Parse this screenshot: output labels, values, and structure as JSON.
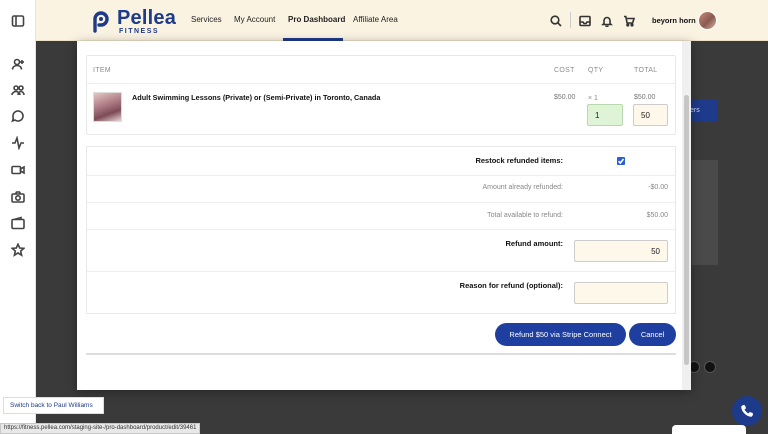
{
  "brand": {
    "name": "Pellea",
    "sub": "FITNESS",
    "color": "#1e3a8a"
  },
  "nav": {
    "links": [
      "Services",
      "My Account",
      "Pro Dashboard",
      "Affiliate Area"
    ],
    "active": "Pro Dashboard"
  },
  "user": {
    "name": "beyorn horn"
  },
  "sidebar": {
    "icons": [
      "panel-toggle-icon",
      "user-add-icon",
      "users-icon",
      "chat-icon",
      "activity-icon",
      "video-icon",
      "camera-icon",
      "wallet-icon",
      "star-icon"
    ]
  },
  "items_table": {
    "headers": {
      "item": "ITEM",
      "cost": "COST",
      "qty": "QTY",
      "total": "TOTAL"
    },
    "row": {
      "name": "Adult Swimming Lessons (Private) or (Semi-Private) in Toronto, Canada",
      "cost": "$50.00",
      "qty_label": "× 1",
      "total": "$50.00",
      "qty_input": "1",
      "total_input": "50"
    }
  },
  "refund": {
    "restock_label": "Restock refunded items:",
    "restock_checked": true,
    "already_refunded_label": "Amount already refunded:",
    "already_refunded_value": "-$0.00",
    "available_label": "Total available to refund:",
    "available_value": "$50.00",
    "amount_label": "Refund amount:",
    "amount_value": "50",
    "reason_label": "Reason for refund (optional):",
    "reason_value": ""
  },
  "actions": {
    "refund_button": "Refund $50 via Stripe Connect",
    "cancel_button": "Cancel"
  },
  "overlays": {
    "switch_back": "Switch back to Paul Williams",
    "status_url": "https://fitness.pellea.com/staging-site-/pro-dashboard/product/edit/39461"
  },
  "colors": {
    "primary_button": "#1e3fa0",
    "topbar_bg": "#fbf3e2",
    "input_highlight": "#fdf8e9",
    "qty_bg": "#dff3d7",
    "checkbox": "#2a5fd8"
  }
}
